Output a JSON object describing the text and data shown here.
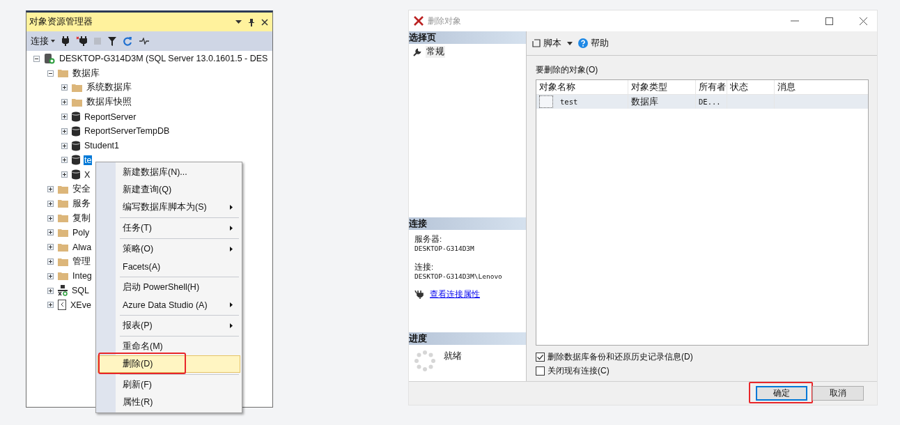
{
  "explorer": {
    "title": "对象资源管理器",
    "connect": "连接",
    "tree": [
      {
        "label": "DESKTOP-G314D3M (SQL Server 13.0.1601.5 - DES",
        "kind": "server",
        "expanded": true,
        "selected": false,
        "children": [
          {
            "label": "数据库",
            "kind": "folder",
            "expanded": true,
            "selected": false,
            "children": [
              {
                "label": "系统数据库",
                "kind": "folder",
                "expanded": false,
                "selected": false
              },
              {
                "label": "数据库快照",
                "kind": "folder",
                "expanded": false,
                "selected": false
              },
              {
                "label": "ReportServer",
                "kind": "database",
                "expanded": false,
                "selected": false
              },
              {
                "label": "ReportServerTempDB",
                "kind": "database",
                "expanded": false,
                "selected": false
              },
              {
                "label": "Student1",
                "kind": "database",
                "expanded": false,
                "selected": false
              },
              {
                "label": "te",
                "kind": "database",
                "expanded": false,
                "selected": true
              },
              {
                "label": "X",
                "kind": "database",
                "expanded": false,
                "selected": false
              }
            ]
          },
          {
            "label": "安全",
            "kind": "folder",
            "expanded": false,
            "selected": false
          },
          {
            "label": "服务",
            "kind": "folder",
            "expanded": false,
            "selected": false
          },
          {
            "label": "复制",
            "kind": "folder",
            "expanded": false,
            "selected": false
          },
          {
            "label": "Poly",
            "kind": "folder",
            "expanded": false,
            "selected": false
          },
          {
            "label": "Alwa",
            "kind": "folder",
            "expanded": false,
            "selected": false
          },
          {
            "label": "管理",
            "kind": "folder",
            "expanded": false,
            "selected": false
          },
          {
            "label": "Integ",
            "kind": "folder",
            "expanded": false,
            "selected": false
          },
          {
            "label": "SQL",
            "kind": "agent",
            "expanded": false,
            "selected": false
          },
          {
            "label": "XEve",
            "kind": "xevent",
            "expanded": false,
            "selected": false
          }
        ]
      }
    ]
  },
  "context_menu": {
    "groups": [
      [
        {
          "label": "新建数据库(N)...",
          "submenu": false,
          "highlighted": false,
          "annotated": false
        },
        {
          "label": "新建查询(Q)",
          "submenu": false,
          "highlighted": false,
          "annotated": false
        },
        {
          "label": "编写数据库脚本为(S)",
          "submenu": true,
          "highlighted": false,
          "annotated": false
        }
      ],
      [
        {
          "label": "任务(T)",
          "submenu": true,
          "highlighted": false,
          "annotated": false
        }
      ],
      [
        {
          "label": "策略(O)",
          "submenu": true,
          "highlighted": false,
          "annotated": false
        },
        {
          "label": "Facets(A)",
          "submenu": false,
          "highlighted": false,
          "annotated": false
        }
      ],
      [
        {
          "label": "启动 PowerShell(H)",
          "submenu": false,
          "highlighted": false,
          "annotated": false
        },
        {
          "label": "Azure Data Studio (A)",
          "submenu": true,
          "highlighted": false,
          "annotated": false
        }
      ],
      [
        {
          "label": "报表(P)",
          "submenu": true,
          "highlighted": false,
          "annotated": false
        }
      ],
      [
        {
          "label": "重命名(M)",
          "submenu": false,
          "highlighted": false,
          "annotated": false
        },
        {
          "label": "删除(D)",
          "submenu": false,
          "highlighted": true,
          "annotated": true
        }
      ],
      [
        {
          "label": "刷新(F)",
          "submenu": false,
          "highlighted": false,
          "annotated": false
        },
        {
          "label": "属性(R)",
          "submenu": false,
          "highlighted": false,
          "annotated": false
        }
      ]
    ]
  },
  "dialog": {
    "title": "删除对象",
    "select_page": {
      "heading": "选择页",
      "pages": [
        {
          "label": "常规",
          "selected": true
        }
      ]
    },
    "connection": {
      "heading": "连接",
      "server_label": "服务器:",
      "server": "DESKTOP-G314D3M",
      "connection_label": "连接:",
      "connection": "DESKTOP-G314D3M\\Lenovo",
      "link": "查看连接属性"
    },
    "progress": {
      "heading": "进度",
      "status": "就绪"
    },
    "toolbar": {
      "script": "脚本",
      "help": "帮助"
    },
    "objects_label": "要删除的对象(O)",
    "columns": [
      "对象名称",
      "对象类型",
      "所有者",
      "状态",
      "消息"
    ],
    "rows": [
      {
        "cells": [
          "test",
          "数据库",
          "DE..."
        ],
        "selected": true
      }
    ],
    "options": [
      {
        "label": "删除数据库备份和还原历史记录信息(D)",
        "checked": true
      },
      {
        "label": "关闭现有连接(C)",
        "checked": false
      }
    ],
    "buttons": [
      {
        "label": "确定",
        "default": true,
        "annotated": true
      },
      {
        "label": "取消",
        "default": false,
        "annotated": false
      }
    ]
  }
}
